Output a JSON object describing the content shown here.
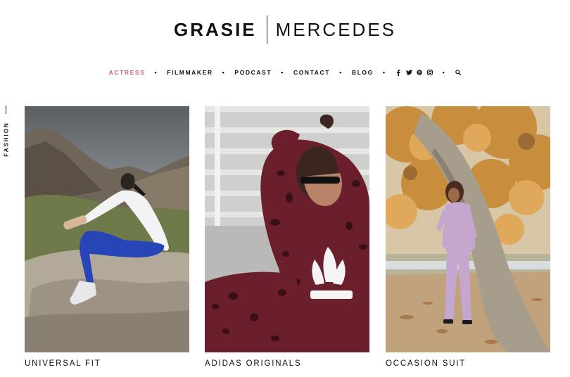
{
  "brand": {
    "first": "GRASIE",
    "last": "MERCEDES"
  },
  "nav": {
    "items": [
      {
        "label": "ACTRESS",
        "active": true
      },
      {
        "label": "FILMMAKER"
      },
      {
        "label": "PODCAST"
      },
      {
        "label": "CONTACT"
      },
      {
        "label": "BLOG"
      }
    ],
    "separator": "•",
    "social_icons": [
      "facebook-icon",
      "twitter-icon",
      "pinterest-icon",
      "instagram-icon"
    ],
    "search_icon": "search-icon"
  },
  "side_label": "FASHION",
  "posts": [
    {
      "caption": "UNIVERSAL FIT"
    },
    {
      "caption": "ADIDAS ORIGINALS"
    },
    {
      "caption": "OCCASION SUIT"
    }
  ],
  "colors": {
    "accent": "#d95d6a",
    "text": "#111111",
    "background": "#ffffff"
  }
}
